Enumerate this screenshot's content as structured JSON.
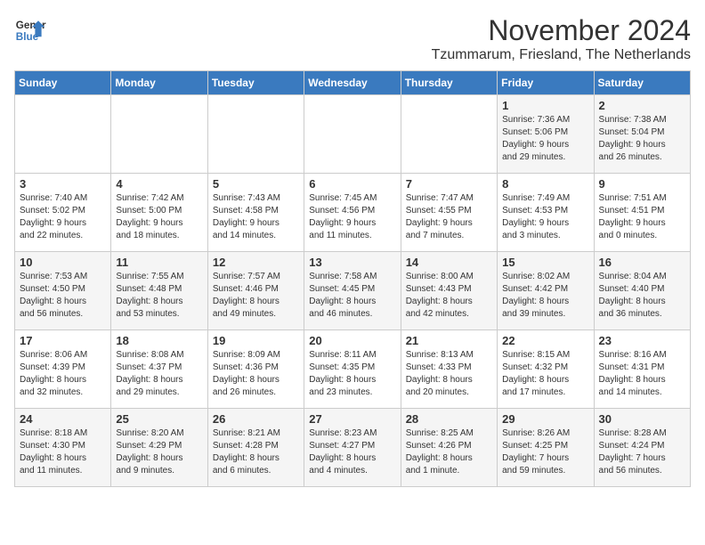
{
  "header": {
    "logo_line1": "General",
    "logo_line2": "Blue",
    "month": "November 2024",
    "location": "Tzummarum, Friesland, The Netherlands"
  },
  "weekdays": [
    "Sunday",
    "Monday",
    "Tuesday",
    "Wednesday",
    "Thursday",
    "Friday",
    "Saturday"
  ],
  "weeks": [
    [
      {
        "day": "",
        "info": ""
      },
      {
        "day": "",
        "info": ""
      },
      {
        "day": "",
        "info": ""
      },
      {
        "day": "",
        "info": ""
      },
      {
        "day": "",
        "info": ""
      },
      {
        "day": "1",
        "info": "Sunrise: 7:36 AM\nSunset: 5:06 PM\nDaylight: 9 hours\nand 29 minutes."
      },
      {
        "day": "2",
        "info": "Sunrise: 7:38 AM\nSunset: 5:04 PM\nDaylight: 9 hours\nand 26 minutes."
      }
    ],
    [
      {
        "day": "3",
        "info": "Sunrise: 7:40 AM\nSunset: 5:02 PM\nDaylight: 9 hours\nand 22 minutes."
      },
      {
        "day": "4",
        "info": "Sunrise: 7:42 AM\nSunset: 5:00 PM\nDaylight: 9 hours\nand 18 minutes."
      },
      {
        "day": "5",
        "info": "Sunrise: 7:43 AM\nSunset: 4:58 PM\nDaylight: 9 hours\nand 14 minutes."
      },
      {
        "day": "6",
        "info": "Sunrise: 7:45 AM\nSunset: 4:56 PM\nDaylight: 9 hours\nand 11 minutes."
      },
      {
        "day": "7",
        "info": "Sunrise: 7:47 AM\nSunset: 4:55 PM\nDaylight: 9 hours\nand 7 minutes."
      },
      {
        "day": "8",
        "info": "Sunrise: 7:49 AM\nSunset: 4:53 PM\nDaylight: 9 hours\nand 3 minutes."
      },
      {
        "day": "9",
        "info": "Sunrise: 7:51 AM\nSunset: 4:51 PM\nDaylight: 9 hours\nand 0 minutes."
      }
    ],
    [
      {
        "day": "10",
        "info": "Sunrise: 7:53 AM\nSunset: 4:50 PM\nDaylight: 8 hours\nand 56 minutes."
      },
      {
        "day": "11",
        "info": "Sunrise: 7:55 AM\nSunset: 4:48 PM\nDaylight: 8 hours\nand 53 minutes."
      },
      {
        "day": "12",
        "info": "Sunrise: 7:57 AM\nSunset: 4:46 PM\nDaylight: 8 hours\nand 49 minutes."
      },
      {
        "day": "13",
        "info": "Sunrise: 7:58 AM\nSunset: 4:45 PM\nDaylight: 8 hours\nand 46 minutes."
      },
      {
        "day": "14",
        "info": "Sunrise: 8:00 AM\nSunset: 4:43 PM\nDaylight: 8 hours\nand 42 minutes."
      },
      {
        "day": "15",
        "info": "Sunrise: 8:02 AM\nSunset: 4:42 PM\nDaylight: 8 hours\nand 39 minutes."
      },
      {
        "day": "16",
        "info": "Sunrise: 8:04 AM\nSunset: 4:40 PM\nDaylight: 8 hours\nand 36 minutes."
      }
    ],
    [
      {
        "day": "17",
        "info": "Sunrise: 8:06 AM\nSunset: 4:39 PM\nDaylight: 8 hours\nand 32 minutes."
      },
      {
        "day": "18",
        "info": "Sunrise: 8:08 AM\nSunset: 4:37 PM\nDaylight: 8 hours\nand 29 minutes."
      },
      {
        "day": "19",
        "info": "Sunrise: 8:09 AM\nSunset: 4:36 PM\nDaylight: 8 hours\nand 26 minutes."
      },
      {
        "day": "20",
        "info": "Sunrise: 8:11 AM\nSunset: 4:35 PM\nDaylight: 8 hours\nand 23 minutes."
      },
      {
        "day": "21",
        "info": "Sunrise: 8:13 AM\nSunset: 4:33 PM\nDaylight: 8 hours\nand 20 minutes."
      },
      {
        "day": "22",
        "info": "Sunrise: 8:15 AM\nSunset: 4:32 PM\nDaylight: 8 hours\nand 17 minutes."
      },
      {
        "day": "23",
        "info": "Sunrise: 8:16 AM\nSunset: 4:31 PM\nDaylight: 8 hours\nand 14 minutes."
      }
    ],
    [
      {
        "day": "24",
        "info": "Sunrise: 8:18 AM\nSunset: 4:30 PM\nDaylight: 8 hours\nand 11 minutes."
      },
      {
        "day": "25",
        "info": "Sunrise: 8:20 AM\nSunset: 4:29 PM\nDaylight: 8 hours\nand 9 minutes."
      },
      {
        "day": "26",
        "info": "Sunrise: 8:21 AM\nSunset: 4:28 PM\nDaylight: 8 hours\nand 6 minutes."
      },
      {
        "day": "27",
        "info": "Sunrise: 8:23 AM\nSunset: 4:27 PM\nDaylight: 8 hours\nand 4 minutes."
      },
      {
        "day": "28",
        "info": "Sunrise: 8:25 AM\nSunset: 4:26 PM\nDaylight: 8 hours\nand 1 minute."
      },
      {
        "day": "29",
        "info": "Sunrise: 8:26 AM\nSunset: 4:25 PM\nDaylight: 7 hours\nand 59 minutes."
      },
      {
        "day": "30",
        "info": "Sunrise: 8:28 AM\nSunset: 4:24 PM\nDaylight: 7 hours\nand 56 minutes."
      }
    ]
  ]
}
